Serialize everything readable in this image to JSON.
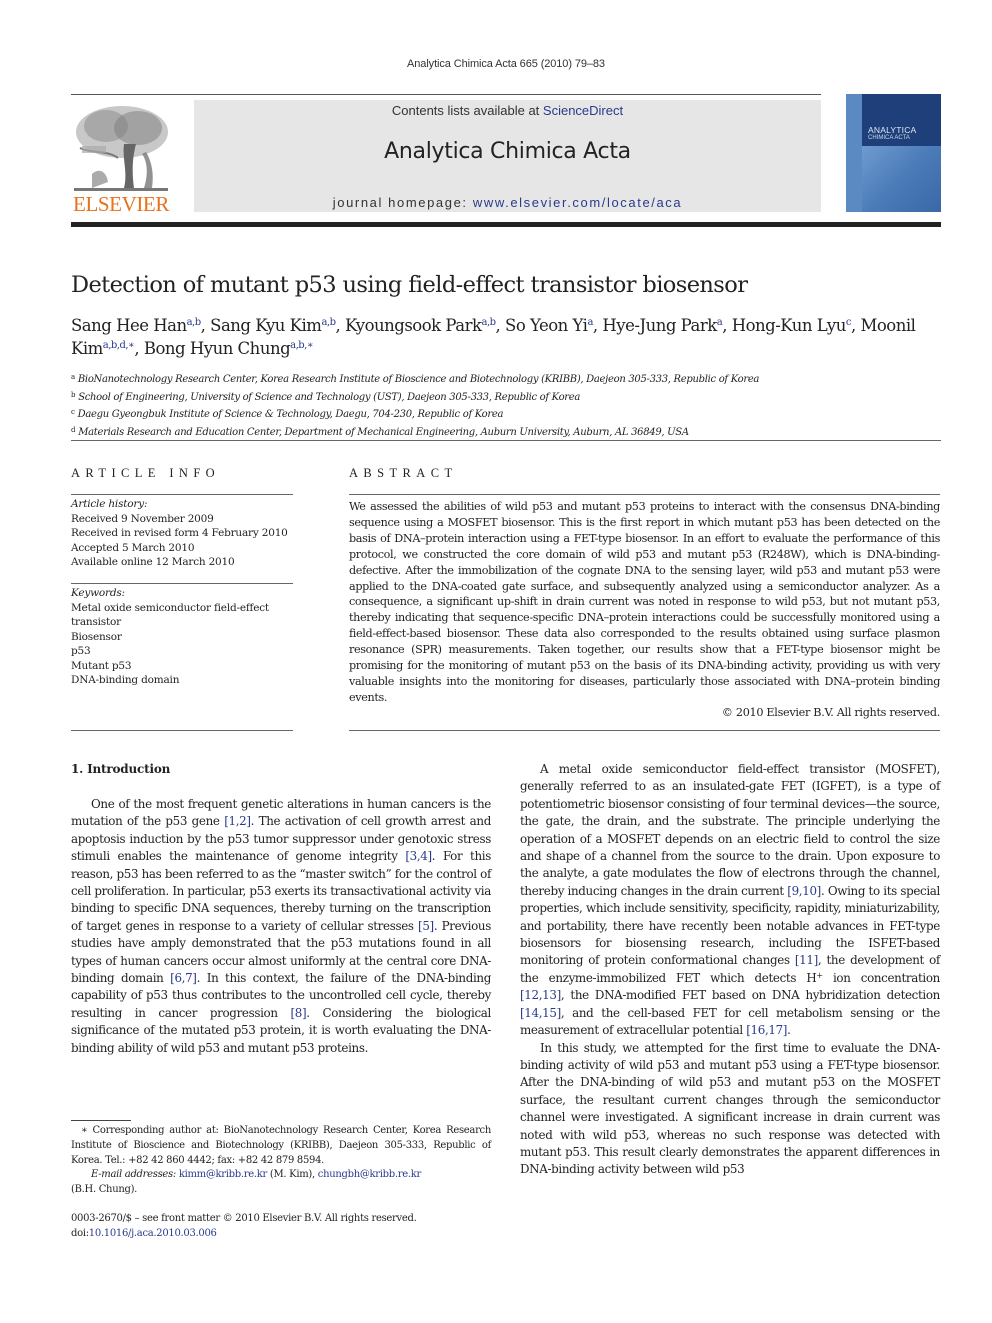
{
  "running_head": "Analytica Chimica Acta 665 (2010) 79–83",
  "header": {
    "publisher_logo": "ELSEVIER",
    "contents_prefix": "Contents lists available at ",
    "contents_link": "ScienceDirect",
    "journal_name": "Analytica Chimica Acta",
    "homepage_prefix": "journal homepage: ",
    "homepage_link": "www.elsevier.com/locate/aca",
    "cover_title_line1": "ANALYTICA",
    "cover_title_line2": "CHIMICA ACTA",
    "colors": {
      "logo_orange": "#e9711c",
      "link_blue": "#2a3a8c",
      "banner_gray": "#e6e6e6",
      "cover_blue": "#1f3f7a"
    }
  },
  "article": {
    "title": "Detection of mutant p53 using field-effect transistor biosensor",
    "authors": [
      {
        "name": "Sang Hee Han",
        "aff": "a,b"
      },
      {
        "name": "Sang Kyu Kim",
        "aff": "a,b"
      },
      {
        "name": "Kyoungsook Park",
        "aff": "a,b"
      },
      {
        "name": "So Yeon Yi",
        "aff": "a"
      },
      {
        "name": "Hye-Jung Park",
        "aff": "a"
      },
      {
        "name": "Hong-Kun Lyu",
        "aff": "c"
      },
      {
        "name": "Moonil Kim",
        "aff": "a,b,d,∗"
      },
      {
        "name": "Bong Hyun Chung",
        "aff": "a,b,∗"
      }
    ],
    "affiliations": [
      {
        "mark": "a",
        "text": "BioNanotechnology Research Center, Korea Research Institute of Bioscience and Biotechnology (KRIBB), Daejeon 305-333, Republic of Korea"
      },
      {
        "mark": "b",
        "text": "School of Engineering, University of Science and Technology (UST), Daejeon 305-333, Republic of Korea"
      },
      {
        "mark": "c",
        "text": "Daegu Gyeongbuk Institute of Science & Technology, Daegu, 704-230, Republic of Korea"
      },
      {
        "mark": "d",
        "text": "Materials Research and Education Center, Department of Mechanical Engineering, Auburn University, Auburn, AL 36849, USA"
      }
    ]
  },
  "article_info": {
    "heading": "ARTICLE INFO",
    "history_label": "Article history:",
    "history": [
      "Received 9 November 2009",
      "Received in revised form 4 February 2010",
      "Accepted 5 March 2010",
      "Available online 12 March 2010"
    ],
    "keywords_label": "Keywords:",
    "keywords": [
      "Metal oxide semiconductor field-effect transistor",
      "Biosensor",
      "p53",
      "Mutant p53",
      "DNA-binding domain"
    ]
  },
  "abstract": {
    "heading": "ABSTRACT",
    "text": "We assessed the abilities of wild p53 and mutant p53 proteins to interact with the consensus DNA-binding sequence using a MOSFET biosensor. This is the first report in which mutant p53 has been detected on the basis of DNA–protein interaction using a FET-type biosensor. In an effort to evaluate the performance of this protocol, we constructed the core domain of wild p53 and mutant p53 (R248W), which is DNA-binding-defective. After the immobilization of the cognate DNA to the sensing layer, wild p53 and mutant p53 were applied to the DNA-coated gate surface, and subsequently analyzed using a semiconductor analyzer. As a consequence, a significant up-shift in drain current was noted in response to wild p53, but not mutant p53, thereby indicating that sequence-specific DNA–protein interactions could be successfully monitored using a field-effect-based biosensor. These data also corresponded to the results obtained using surface plasmon resonance (SPR) measurements. Taken together, our results show that a FET-type biosensor might be promising for the monitoring of mutant p53 on the basis of its DNA-binding activity, providing us with very valuable insights into the monitoring for diseases, particularly those associated with DNA–protein binding events.",
    "copyright": "© 2010 Elsevier B.V. All rights reserved."
  },
  "introduction": {
    "heading": "1.  Introduction",
    "left_paragraph": [
      {
        "t": "One of the most frequent genetic alterations in human cancers is the mutation of the p53 gene "
      },
      {
        "ref": "[1,2]"
      },
      {
        "t": ". The activation of cell growth arrest and apoptosis induction by the p53 tumor suppressor under genotoxic stress stimuli enables the maintenance of genome integrity "
      },
      {
        "ref": "[3,4]"
      },
      {
        "t": ". For this reason, p53 has been referred to as the “master switch” for the control of cell proliferation. In particular, p53 exerts its transactivational activity via binding to specific DNA sequences, thereby turning on the transcription of target genes in response to a variety of cellular stresses "
      },
      {
        "ref": "[5]"
      },
      {
        "t": ". Previous studies have amply demonstrated that the p53 mutations found in all types of human cancers occur almost uniformly at the central core DNA-binding domain "
      },
      {
        "ref": "[6,7]"
      },
      {
        "t": ". In this context, the failure of the DNA-binding capability of p53 thus contributes to the uncontrolled cell cycle, thereby resulting in cancer progression "
      },
      {
        "ref": "[8]"
      },
      {
        "t": ". Considering the biological significance of the mutated p53 protein, it is worth evaluating the DNA-binding ability of wild p53 and mutant p53 proteins."
      }
    ],
    "right_paragraph_1": [
      {
        "t": "A metal oxide semiconductor field-effect transistor (MOSFET), generally referred to as an insulated-gate FET (IGFET), is a type of potentiometric biosensor consisting of four terminal devices—the source, the gate, the drain, and the substrate. The principle underlying the operation of a MOSFET depends on an electric field to control the size and shape of a channel from the source to the drain. Upon exposure to the analyte, a gate modulates the flow of electrons through the channel, thereby inducing changes in the drain current "
      },
      {
        "ref": "[9,10]"
      },
      {
        "t": ". Owing to its special properties, which include sensitivity, specificity, rapidity, miniaturizability, and portability, there have recently been notable advances in FET-type biosensors for biosensing research, including the ISFET-based monitoring of protein conformational changes "
      },
      {
        "ref": "[11]"
      },
      {
        "t": ", the development of the enzyme-immobilized FET which detects H"
      },
      {
        "sup": "+"
      },
      {
        "t": " ion concentration "
      },
      {
        "ref": "[12,13]"
      },
      {
        "t": ", the DNA-modified FET based on DNA hybridization detection "
      },
      {
        "ref": "[14,15]"
      },
      {
        "t": ", and the cell-based FET for cell metabolism sensing or the measurement of extracellular potential "
      },
      {
        "ref": "[16,17]"
      },
      {
        "t": "."
      }
    ],
    "right_paragraph_2": [
      {
        "t": "In this study, we attempted for the first time to evaluate the DNA-binding activity of wild p53 and mutant p53 using a FET-type biosensor. After the DNA-binding of wild p53 and mutant p53 on the MOSFET surface, the resultant current changes through the semiconductor channel were investigated. A significant increase in drain current was noted with wild p53, whereas no such response was detected with mutant p53. This result clearly demonstrates the apparent differences in DNA-binding activity between wild p53"
      }
    ]
  },
  "footnote": {
    "corresponding": "∗ Corresponding author at: BioNanotechnology Research Center, Korea Research Institute of Bioscience and Biotechnology (KRIBB), Daejeon 305-333, Republic of Korea. Tel.: +82 42 860 4442; fax: +82 42 879 8594.",
    "email_label": "E-mail addresses: ",
    "email_1": "kimm@kribb.re.kr",
    "email_1_owner": " (M. Kim), ",
    "email_2": "chungbh@kribb.re.kr",
    "email_2_owner": "(B.H. Chung).",
    "front_matter": "0003-2670/$ – see front matter © 2010 Elsevier B.V. All rights reserved.",
    "doi_prefix": "doi:",
    "doi": "10.1016/j.aca.2010.03.006"
  }
}
